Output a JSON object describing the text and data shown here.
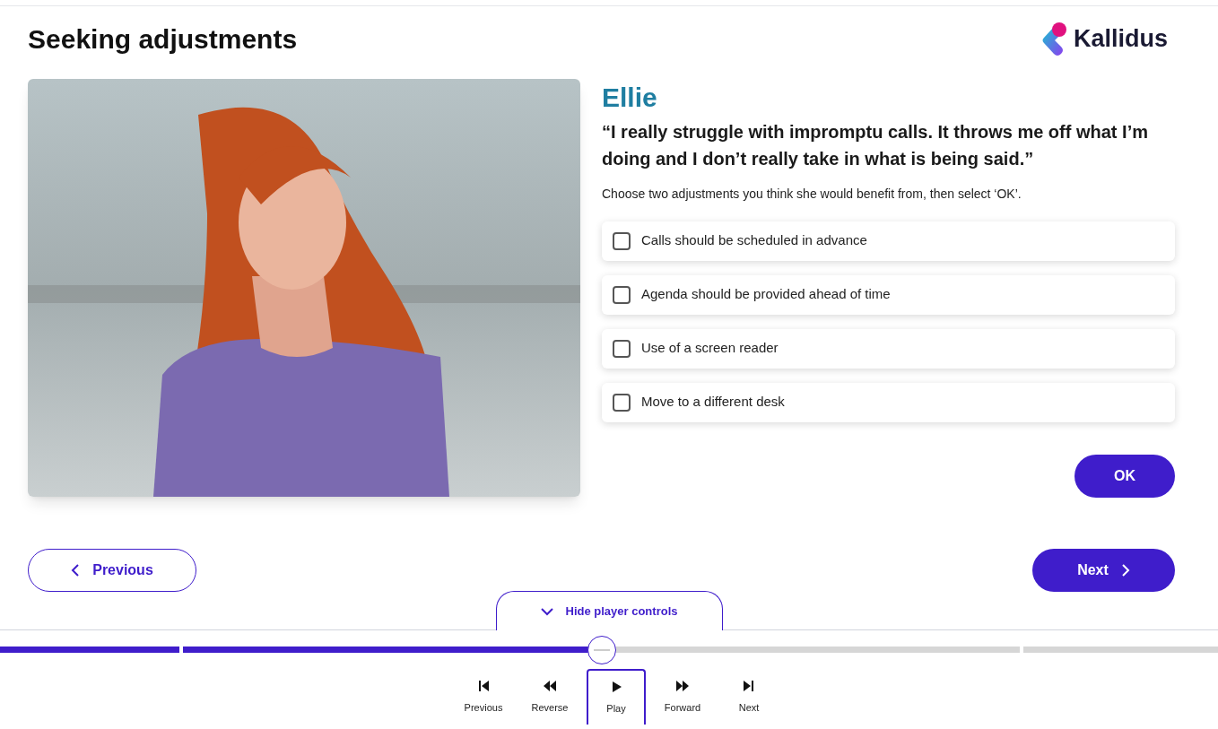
{
  "header": {
    "title": "Seeking adjustments",
    "logo_text": "Kallidus"
  },
  "character": {
    "name": "Ellie",
    "quote": "“I really struggle with impromptu calls. It throws me off what I’m doing and I don’t really take in what is being said.”",
    "instruction": "Choose two adjustments you think she would benefit from, then select ‘OK’."
  },
  "options": [
    {
      "label": "Calls should be scheduled in advance",
      "checked": false
    },
    {
      "label": "Agenda should be provided ahead of time",
      "checked": false
    },
    {
      "label": "Use of a screen reader",
      "checked": false
    },
    {
      "label": "Move to a different desk",
      "checked": false
    }
  ],
  "ok_button": "OK",
  "nav": {
    "previous": "Previous",
    "next": "Next"
  },
  "player_toggle": "Hide player controls",
  "progress": {
    "level": 0.494
  },
  "player_controls": [
    {
      "kind": "first",
      "label": "Previous",
      "selected": false
    },
    {
      "kind": "reverse",
      "label": "Reverse",
      "selected": false
    },
    {
      "kind": "play",
      "label": "Play",
      "selected": true
    },
    {
      "kind": "forward",
      "label": "Forward",
      "selected": false
    },
    {
      "kind": "last",
      "label": "Next",
      "selected": false
    }
  ]
}
